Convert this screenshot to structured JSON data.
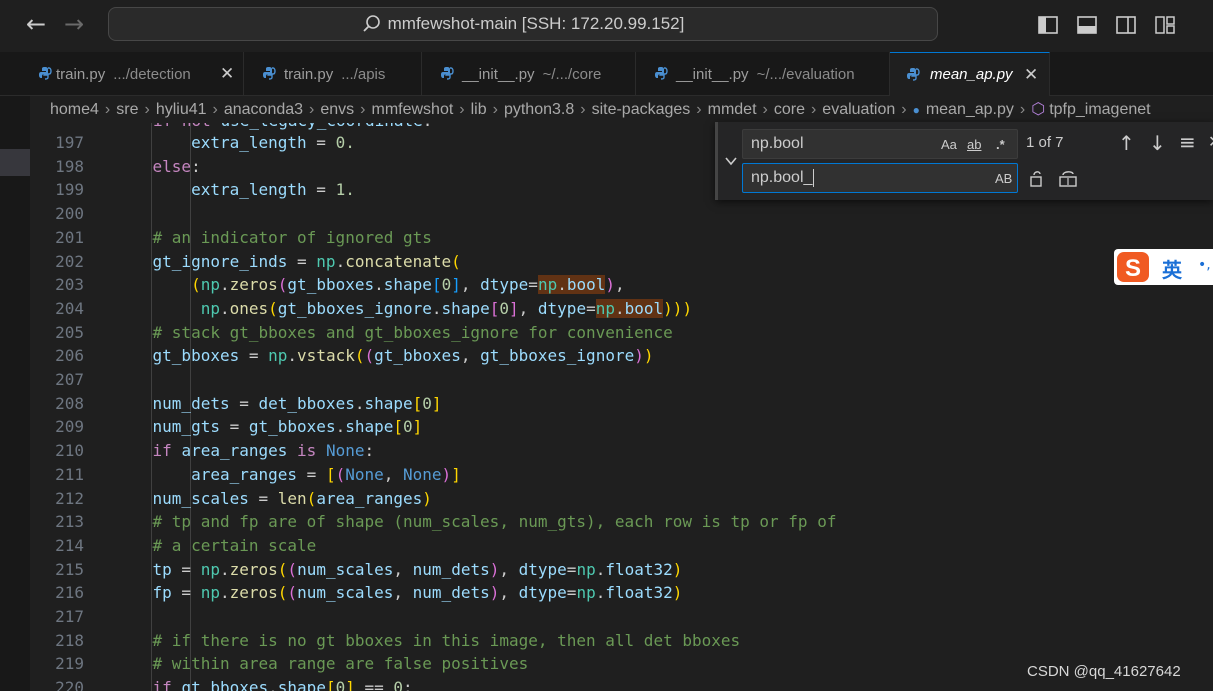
{
  "titlebar": {
    "back_icon": "arrow-left-icon",
    "forward_icon": "arrow-right-icon",
    "search_text": "mmfewshot-main [SSH: 172.20.99.152]",
    "layout_icons": [
      "toggle-primary-sidebar-icon",
      "toggle-panel-icon",
      "toggle-secondary-sidebar-icon",
      "customize-layout-icon"
    ]
  },
  "tabs": [
    {
      "label": "train.py",
      "desc": ".../detection",
      "active": false,
      "close": "✕"
    },
    {
      "label": "train.py",
      "desc": ".../apis",
      "active": false,
      "close": ""
    },
    {
      "label": "__init__.py",
      "desc": "~/.../core",
      "active": false,
      "close": ""
    },
    {
      "label": "__init__.py",
      "desc": "~/.../evaluation",
      "active": false,
      "close": ""
    },
    {
      "label": "mean_ap.py",
      "desc": "",
      "active": true,
      "close": "✕"
    }
  ],
  "breadcrumbs": [
    "home4",
    "sre",
    "hyliu41",
    "anaconda3",
    "envs",
    "mmfewshot",
    "lib",
    "python3.8",
    "site-packages",
    "mmdet",
    "core",
    "evaluation",
    "mean_ap.py",
    "tpfp_imagenet"
  ],
  "code": {
    "partial_top_line": "if not use_legacy_coordinate:",
    "lines": [
      {
        "n": "197",
        "text": "        extra_length = 0."
      },
      {
        "n": "198",
        "text": "    else:"
      },
      {
        "n": "199",
        "text": "        extra_length = 1."
      },
      {
        "n": "200",
        "text": ""
      },
      {
        "n": "201",
        "text": "    # an indicator of ignored gts"
      },
      {
        "n": "202",
        "text": "    gt_ignore_inds = np.concatenate("
      },
      {
        "n": "203",
        "text": "        (np.zeros(gt_bboxes.shape[0], dtype=np.bool),"
      },
      {
        "n": "204",
        "text": "         np.ones(gt_bboxes_ignore.shape[0], dtype=np.bool)))"
      },
      {
        "n": "205",
        "text": "    # stack gt_bboxes and gt_bboxes_ignore for convenience"
      },
      {
        "n": "206",
        "text": "    gt_bboxes = np.vstack((gt_bboxes, gt_bboxes_ignore))"
      },
      {
        "n": "207",
        "text": ""
      },
      {
        "n": "208",
        "text": "    num_dets = det_bboxes.shape[0]"
      },
      {
        "n": "209",
        "text": "    num_gts = gt_bboxes.shape[0]"
      },
      {
        "n": "210",
        "text": "    if area_ranges is None:"
      },
      {
        "n": "211",
        "text": "        area_ranges = [(None, None)]"
      },
      {
        "n": "212",
        "text": "    num_scales = len(area_ranges)"
      },
      {
        "n": "213",
        "text": "    # tp and fp are of shape (num_scales, num_gts), each row is tp or fp of"
      },
      {
        "n": "214",
        "text": "    # a certain scale"
      },
      {
        "n": "215",
        "text": "    tp = np.zeros((num_scales, num_dets), dtype=np.float32)"
      },
      {
        "n": "216",
        "text": "    fp = np.zeros((num_scales, num_dets), dtype=np.float32)"
      },
      {
        "n": "217",
        "text": ""
      },
      {
        "n": "218",
        "text": "    # if there is no gt bboxes in this image, then all det bboxes"
      },
      {
        "n": "219",
        "text": "    # within area range are false positives"
      },
      {
        "n": "220",
        "text": "    if gt_bboxes.shape[0] == 0:"
      }
    ]
  },
  "find": {
    "query": "np.bool",
    "replace_value": "np.bool_",
    "match_case": "Aa",
    "whole_word": "ab",
    "regex": ".*",
    "preserve_case": "AB",
    "count": "1 of 7",
    "icons": [
      "toggle-replace-icon",
      "previous-match-icon",
      "next-match-icon",
      "find-in-selection-icon",
      "close-icon",
      "replace-icon",
      "replace-all-icon"
    ]
  },
  "ime": {
    "label": "英",
    "logo": "sogou-logo"
  },
  "watermark": "CSDN @qq_41627642",
  "colors": {
    "keyword": "#c586c0",
    "comment": "#6a9955",
    "function": "#dcdcaa",
    "variable": "#9cdcfe",
    "module": "#4ec9b0",
    "constant": "#569cd6",
    "number": "#b5cea8",
    "bracket1": "#ffd700",
    "bracket2": "#da70d6",
    "bracket3": "#179fff",
    "match": "#613214",
    "accent": "#0078d4"
  }
}
